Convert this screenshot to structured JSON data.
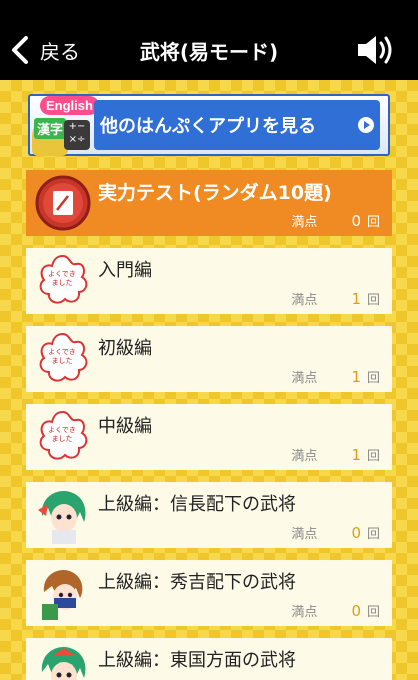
{
  "header": {
    "back_label": "戻る",
    "title": "武将(易モード)"
  },
  "banner": {
    "tag_english": "English",
    "tag_kanji": "漢字",
    "calc_text": "+−\n×÷",
    "text": "他のはんぷくアプリを見る"
  },
  "items": [
    {
      "name": "実力テスト(ランダム10題)",
      "score_label": "満点",
      "count": "0",
      "unit": "回",
      "badge": "test-icon"
    },
    {
      "name": "入門編",
      "score_label": "満点",
      "count": "1",
      "unit": "回",
      "badge": "flower-stamp"
    },
    {
      "name": "初級編",
      "score_label": "満点",
      "count": "1",
      "unit": "回",
      "badge": "flower-stamp"
    },
    {
      "name": "中級編",
      "score_label": "満点",
      "count": "1",
      "unit": "回",
      "badge": "flower-stamp"
    },
    {
      "name": "上級編：信長配下の武将",
      "score_label": "満点",
      "count": "0",
      "unit": "回",
      "badge": "character-avatar"
    },
    {
      "name": "上級編：秀吉配下の武将",
      "score_label": "満点",
      "count": "0",
      "unit": "回",
      "badge": "character-avatar"
    },
    {
      "name": "上級編：東国方面の武将",
      "score_label": "満点",
      "count": "0",
      "unit": "回",
      "badge": "character-avatar"
    }
  ],
  "colors": {
    "header_bg": "#000000",
    "page_bg": "#f5d23a",
    "test_card": "#f08a22",
    "card_bg": "#fdfbe8",
    "count_color": "#e29b1a"
  }
}
